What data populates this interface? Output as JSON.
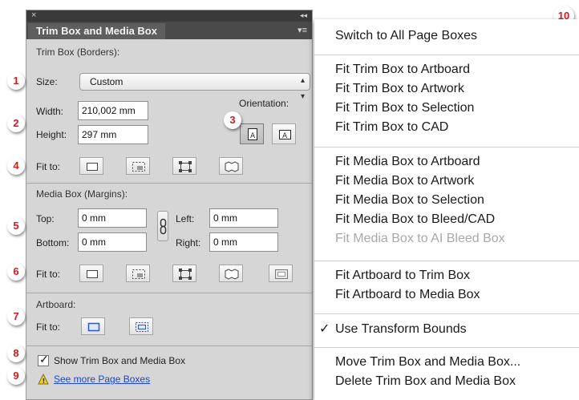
{
  "panel": {
    "title": "Trim Box and Media Box",
    "trim": {
      "section": "Trim Box (Borders):",
      "size_label": "Size:",
      "size_value": "Custom",
      "width_label": "Width:",
      "width_value": "210,002 mm",
      "height_label": "Height:",
      "height_value": "297 mm",
      "orientation_label": "Orientation:",
      "fit_label": "Fit to:"
    },
    "media": {
      "section": "Media Box (Margins):",
      "top_label": "Top:",
      "top_value": "0 mm",
      "bottom_label": "Bottom:",
      "bottom_value": "0 mm",
      "left_label": "Left:",
      "left_value": "0 mm",
      "right_label": "Right:",
      "right_value": "0 mm",
      "fit_label": "Fit to:"
    },
    "artboard": {
      "section": "Artboard:",
      "fit_label": "Fit to:"
    },
    "show_label": "Show Trim Box and Media Box",
    "show_checked": true,
    "see_more": "See more Page Boxes"
  },
  "callouts": [
    "1",
    "2",
    "3",
    "4",
    "5",
    "6",
    "7",
    "8",
    "9",
    "10"
  ],
  "menu": {
    "items": [
      "Switch to All Page Boxes",
      "Fit Trim Box to Artboard",
      "Fit Trim Box to Artwork",
      "Fit Trim Box to Selection",
      "Fit Trim Box to CAD",
      "Fit Media Box to Artboard",
      "Fit Media Box to Artwork",
      "Fit Media Box to Selection",
      "Fit Media Box to Bleed/CAD",
      "Fit Media Box to AI Bleed Box",
      "Fit Artboard to Trim Box",
      "Fit Artboard to Media Box",
      "Use Transform Bounds",
      "Move Trim Box and Media Box...",
      "Delete Trim Box and Media Box"
    ],
    "disabled_item": "Fit Media Box to AI Bleed Box",
    "checked_item": "Use Transform Bounds"
  },
  "colors": {
    "callout": "#d31b1b",
    "link": "#1a47d9",
    "artboard_icon": "#2a55d6"
  }
}
